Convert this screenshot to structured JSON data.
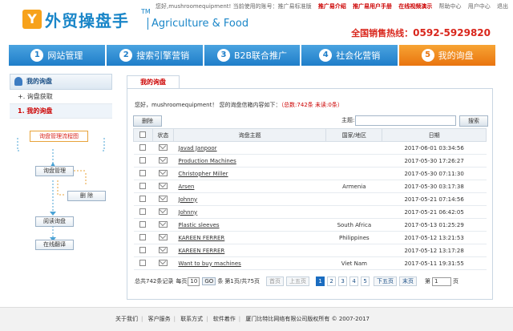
{
  "top_bar": {
    "greeting": "您好,mushroomequipment! 当前使用的账号：推广易标准版",
    "links": [
      "推广易介绍",
      "推广易用户手册",
      "在线视频演示",
      "帮助中心",
      "用户中心",
      "退出"
    ]
  },
  "brand": {
    "logo_char": "Y",
    "name": "外贸操盘手",
    "tm": "TM",
    "subtitle": "Agriculture & Food"
  },
  "hotline": {
    "label": "全国销售热线：",
    "number": "0592-5929820"
  },
  "nav": [
    {
      "num": "1",
      "label": "网站管理"
    },
    {
      "num": "2",
      "label": "搜索引擎营销"
    },
    {
      "num": "3",
      "label": "B2B联合推广"
    },
    {
      "num": "4",
      "label": "社会化营销"
    },
    {
      "num": "5",
      "label": "我的询盘"
    }
  ],
  "sidebar": {
    "title": "我的询盘",
    "items": [
      "+. 询盘获取",
      "1. 我的询盘"
    ]
  },
  "flowchart": {
    "title": "询盘管理流程图",
    "steps": [
      "询盘管理",
      "删 除",
      "阅读询盘",
      "在线翻译"
    ]
  },
  "tab": {
    "label": "我的询盘"
  },
  "summary": {
    "greeting": "您好，mushroomequipment！ 您的询盘信箱内容如下：",
    "stats": "（总数:742条  未读:0条）"
  },
  "toolbar": {
    "delete_label": "删除",
    "keyword_label": "主题:",
    "keyword_value": "",
    "search_label": "搜索"
  },
  "table": {
    "headers": [
      "",
      "状态",
      "询盘主题",
      "国家/地区",
      "日期"
    ],
    "rows": [
      {
        "subject": "Javad Janpoor",
        "country": "",
        "date": "2017-06-01 03:34:56"
      },
      {
        "subject": "Production Machines",
        "country": "",
        "date": "2017-05-30 17:26:27"
      },
      {
        "subject": "Christopher Miller",
        "country": "",
        "date": "2017-05-30 07:11:30"
      },
      {
        "subject": "Arsen",
        "country": "Armenia",
        "date": "2017-05-30 03:17:38"
      },
      {
        "subject": "Johnny",
        "country": "",
        "date": "2017-05-21 07:14:56"
      },
      {
        "subject": "Johnny",
        "country": "",
        "date": "2017-05-21 06:42:05"
      },
      {
        "subject": "Plastic sleeves",
        "country": "South Africa",
        "date": "2017-05-13 01:25:29"
      },
      {
        "subject": "KAREEN FERRER",
        "country": "Philippines",
        "date": "2017-05-12 13:21:53"
      },
      {
        "subject": "KAREEN FERRER",
        "country": "",
        "date": "2017-05-12 13:17:28"
      },
      {
        "subject": "Want to buy machines",
        "country": "Viet Nam",
        "date": "2017-05-11 19:31:55"
      }
    ]
  },
  "pager": {
    "total": "总共742条记录",
    "per_page_label": "每页",
    "per_page": "10",
    "go": "GO",
    "unit": "条",
    "page_info": "第1页/共75页",
    "first": "首页",
    "prev5": "上五页",
    "pages": [
      "1",
      "2",
      "3",
      "4",
      "5"
    ],
    "next5": "下五页",
    "last": "末页",
    "page_label": "第",
    "page_select": "1",
    "page_suffix": "页"
  },
  "footer": {
    "links": [
      "关于我们",
      "客户服务",
      "联系方式",
      "软件着作"
    ],
    "copyright": "厦门比特比网络有限公司版权所有 © 2007-2017"
  }
}
